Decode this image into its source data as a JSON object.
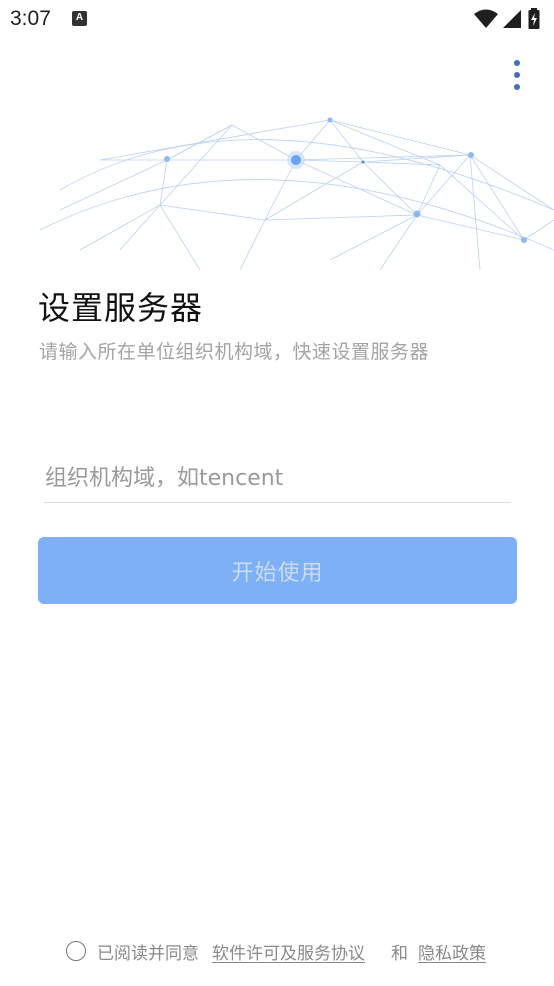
{
  "status_bar": {
    "time": "3:07",
    "notification_icon": "A",
    "icons": [
      "wifi-icon",
      "signal-icon",
      "battery-charging-icon"
    ]
  },
  "menu": {
    "icon": "more-vert-icon"
  },
  "header": {
    "title": "设置服务器",
    "subtitle": "请输入所在单位组织机构域，快速设置服务器"
  },
  "form": {
    "domain_placeholder": "组织机构域，如tencent",
    "domain_value": "",
    "start_label": "开始使用"
  },
  "agreement": {
    "checked": false,
    "prefix": "已阅读并同意",
    "license_link": "软件许可及服务协议",
    "conjunction": "和",
    "privacy_link": "隐私政策"
  },
  "colors": {
    "accent": "#3f6fbf",
    "button_bg": "#7eb0f5",
    "button_text": "#c9dcfa",
    "globe_lines": "#a9c6ef"
  }
}
